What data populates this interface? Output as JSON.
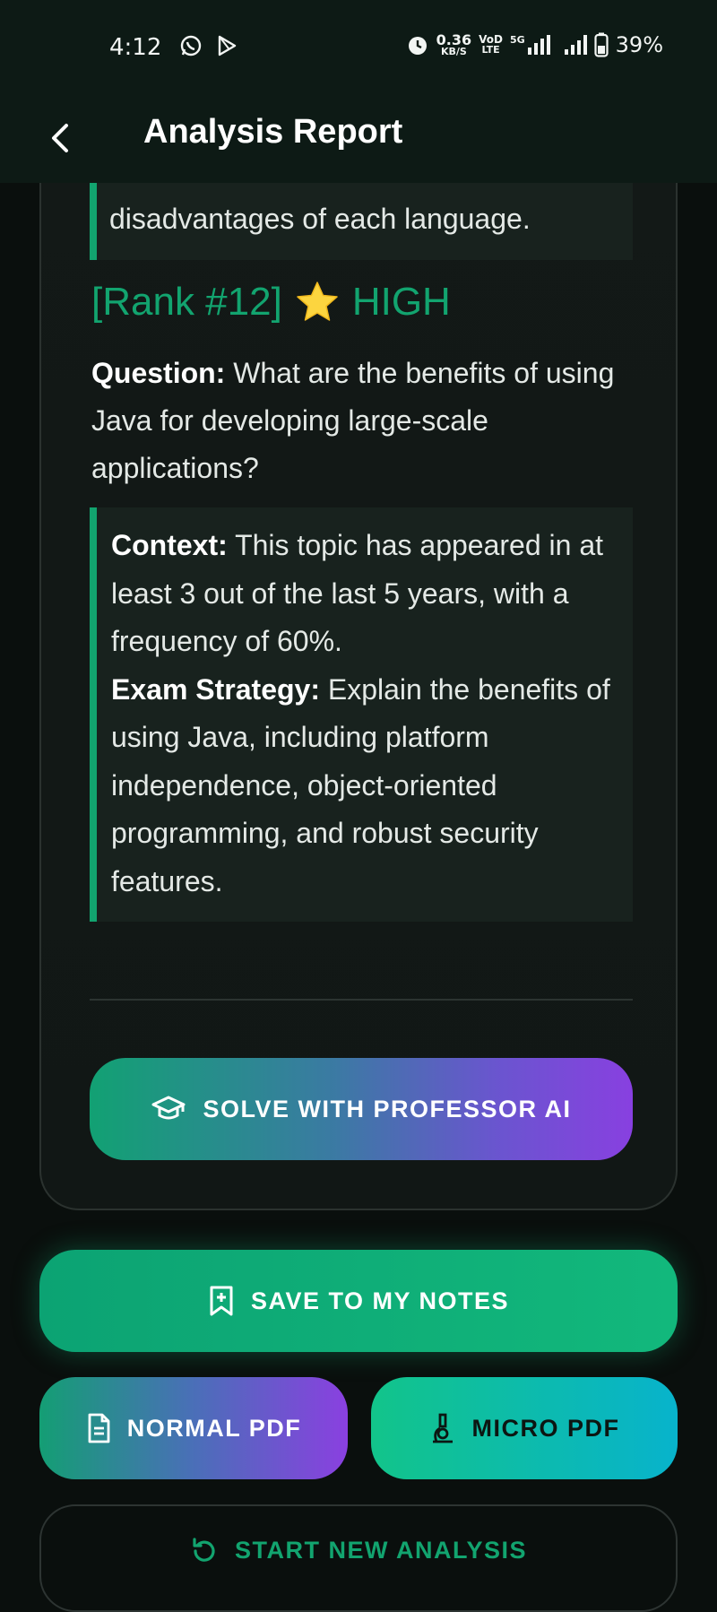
{
  "status_bar": {
    "time": "4:12",
    "speed_value": "0.36",
    "speed_unit": "KB/S",
    "volte_top": "VoD",
    "volte_bottom": "LTE",
    "network": "5G",
    "battery": "39%"
  },
  "app_bar": {
    "title": "Analysis Report"
  },
  "report": {
    "prev_context_tail": "disadvantages of each language.",
    "rank_label": "[Rank #12]",
    "priority": "HIGH",
    "question_label": "Question:",
    "question_text": "What are the benefits of using Java for developing large-scale applications?",
    "context_label": "Context:",
    "context_text": "This topic has appeared in at least 3 out of the last 5 years, with a frequency of 60%.",
    "strategy_label": "Exam Strategy:",
    "strategy_text": "Explain the benefits of using Java, including platform independence, object-oriented programming, and robust security features."
  },
  "actions": {
    "professor_label": "SOLVE WITH PROFESSOR AI",
    "save_label": "SAVE TO MY NOTES",
    "normal_pdf_label": "NORMAL PDF",
    "micro_pdf_label": "MICRO PDF",
    "new_analysis_label": "START NEW ANALYSIS"
  },
  "icons": {
    "professor": "graduation-cap-icon",
    "save": "bookmark-plus-icon",
    "normal_pdf": "document-icon",
    "micro_pdf": "microscope-icon",
    "new_analysis": "refresh-icon"
  },
  "colors": {
    "accent": "#12a46f",
    "background": "#0a0f0d",
    "header": "#0d1a15"
  }
}
